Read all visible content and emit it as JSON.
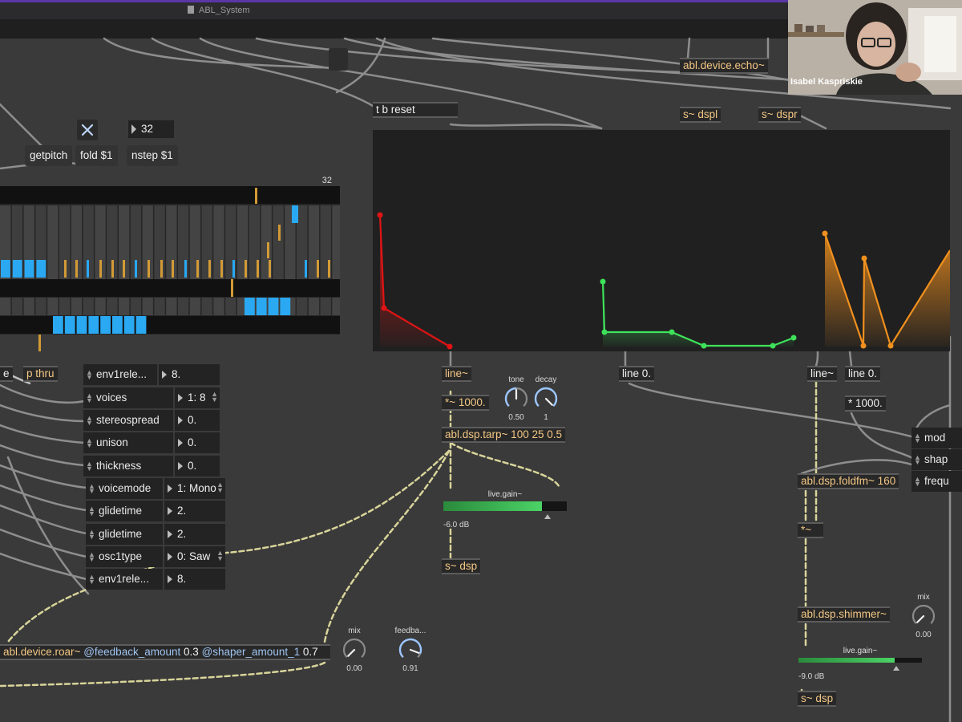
{
  "window": {
    "title": "ABL_System"
  },
  "video": {
    "participant_name": "Isabel Kaspriskie"
  },
  "controls": {
    "close_toggle": "×",
    "number_32": "32",
    "seq_length": "32"
  },
  "messages": {
    "getpitch": "getpitch",
    "fold": "fold $1",
    "nstep": "nstep $1",
    "mod": "mod",
    "shap": "shap",
    "frequ": "frequ"
  },
  "objects": {
    "echo": "abl.device.echo~",
    "dspl": "s~ dspl",
    "dspr": "s~ dspr",
    "tbreset": "t b reset",
    "line1": "line~",
    "mul1000a": "*~ 1000.",
    "tarp": "abl.dsp.tarp~ 100 25 0.5",
    "sdsp1": "s~ dsp",
    "line0a": "line 0.",
    "line2": "line~",
    "line0b": "line 0.",
    "mul1000b": "* 1000.",
    "foldfm": "abl.dsp.foldfm~ 160",
    "mulsig": "*~",
    "shimmer": "abl.dsp.shimmer~",
    "sdsp2": "s~ dsp",
    "pthru": "p thru",
    "e_stub": "e",
    "roar_name": "abl.device.roar~",
    "roar_attr1": "@feedback_amount",
    "roar_val1": "0.3",
    "roar_attr2": "@shaper_amount_1",
    "roar_val2": "0.7"
  },
  "attrui": [
    {
      "name": "env1rele...",
      "value": "8."
    },
    {
      "name": "voices",
      "value": "1: 8"
    },
    {
      "name": "stereospread",
      "value": "0."
    },
    {
      "name": "unison",
      "value": "0."
    },
    {
      "name": "thickness",
      "value": "0."
    },
    {
      "name": "voicemode",
      "value": "1: Mono"
    },
    {
      "name": "glidetime",
      "value": "2."
    },
    {
      "name": "glidetime",
      "value": "2."
    },
    {
      "name": "osc1type",
      "value": "0: Saw"
    },
    {
      "name": "env1rele...",
      "value": "8."
    }
  ],
  "dials": {
    "tone": {
      "label": "tone",
      "value": "0.50",
      "fraction": 0.5
    },
    "decay": {
      "label": "decay",
      "value": "1",
      "fraction": 1.0
    },
    "mix_roar": {
      "label": "mix",
      "value": "0.00",
      "fraction": 0.0
    },
    "feedback": {
      "label": "feedba...",
      "value": "0.91",
      "fraction": 0.91
    },
    "mix_shimmer": {
      "label": "mix",
      "value": "0.00",
      "fraction": 0.0
    }
  },
  "meters": {
    "gain1": {
      "label": "live.gain~",
      "db": "-6.0 dB",
      "level": 0.8
    },
    "gain2": {
      "label": "live.gain~",
      "db": "-9.0 dB",
      "level": 0.78
    }
  },
  "colors": {
    "env_red": "#e01414",
    "env_green": "#3ee25a",
    "env_orange": "#f0901e",
    "seq_blue": "#2aa8f2",
    "seq_orange": "#d29a36",
    "object_yellow": "#f3c784",
    "title_accent": "#5a36a8"
  }
}
